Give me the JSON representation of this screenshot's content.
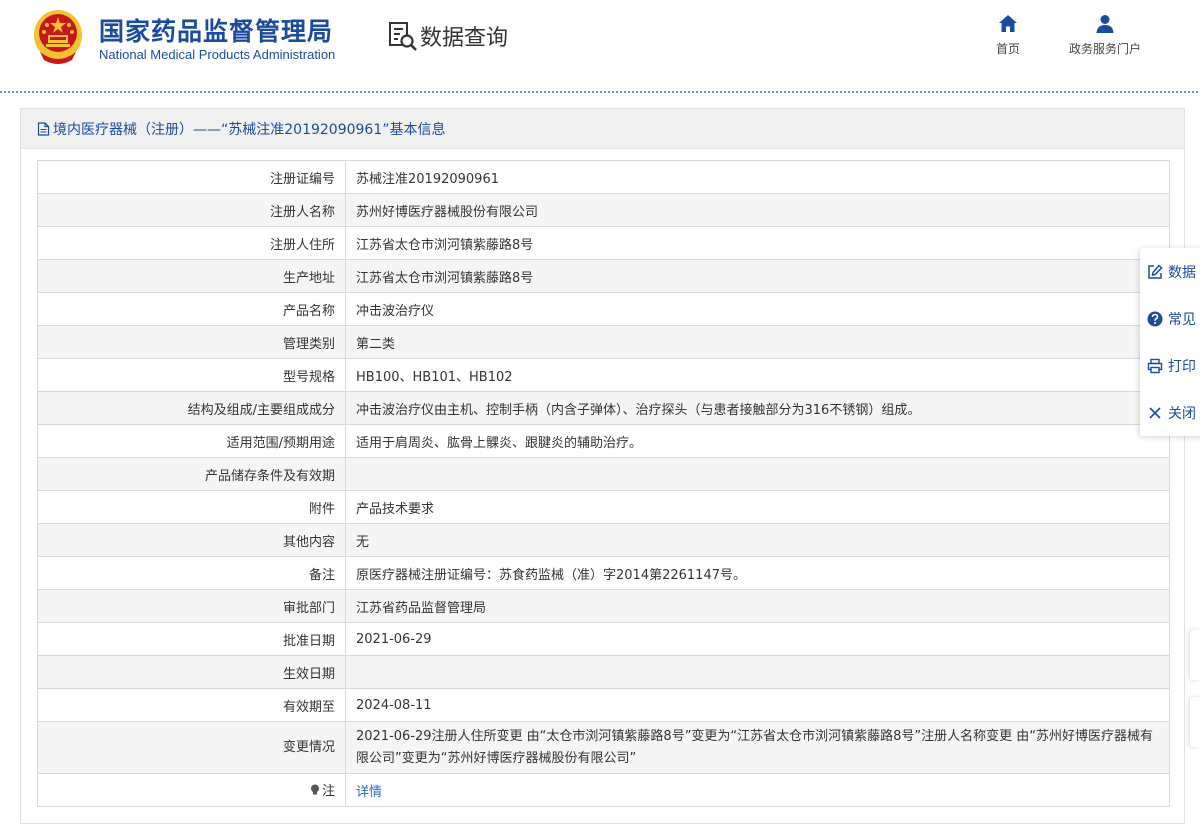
{
  "header": {
    "agency_cn": "国家药品监督管理局",
    "agency_en": "National Medical Products Administration",
    "query_title": "数据查询",
    "nav": {
      "home": "首页",
      "portal": "政务服务门户"
    }
  },
  "panel": {
    "title": "境内医疗器械（注册）——“苏械注准20192090961”基本信息"
  },
  "rows": [
    {
      "label": "注册证编号",
      "value": "苏械注准20192090961"
    },
    {
      "label": "注册人名称",
      "value": "苏州好博医疗器械股份有限公司"
    },
    {
      "label": "注册人住所",
      "value": "江苏省太仓市浏河镇紫藤路8号"
    },
    {
      "label": "生产地址",
      "value": "江苏省太仓市浏河镇紫藤路8号"
    },
    {
      "label": "产品名称",
      "value": "冲击波治疗仪"
    },
    {
      "label": "管理类别",
      "value": "第二类"
    },
    {
      "label": "型号规格",
      "value": "HB100、HB101、HB102"
    },
    {
      "label": "结构及组成/主要组成成分",
      "value": "冲击波治疗仪由主机、控制手柄（内含子弹体）、治疗探头（与患者接触部分为316不锈钢）组成。"
    },
    {
      "label": "适用范围/预期用途",
      "value": "适用于肩周炎、肱骨上髁炎、跟腱炎的辅助治疗。"
    },
    {
      "label": "产品储存条件及有效期",
      "value": ""
    },
    {
      "label": "附件",
      "value": "产品技术要求"
    },
    {
      "label": "其他内容",
      "value": "无"
    },
    {
      "label": "备注",
      "value": "原医疗器械注册证编号：苏食药监械（准）字2014第2261147号。"
    },
    {
      "label": "审批部门",
      "value": "江苏省药品监督管理局"
    },
    {
      "label": "批准日期",
      "value": "2021-06-29"
    },
    {
      "label": "生效日期",
      "value": ""
    },
    {
      "label": "有效期至",
      "value": "2024-08-11"
    },
    {
      "label": "变更情况",
      "value": "2021-06-29注册人住所变更 由“太仓市浏河镇紫藤路8号”变更为“江苏省太仓市浏河镇紫藤路8号”注册人名称变更 由“苏州好博医疗器械有限公司”变更为“苏州好博医疗器械股份有限公司”"
    }
  ],
  "note": {
    "label": "注",
    "link": "详情"
  },
  "float_menu": [
    {
      "icon": "edit-icon",
      "label": "数据"
    },
    {
      "icon": "question-icon",
      "label": "常见"
    },
    {
      "icon": "printer-icon",
      "label": "打印"
    },
    {
      "icon": "close-icon",
      "label": "关闭"
    }
  ],
  "colors": {
    "brand": "#1b4c9b",
    "link": "#2a6bc1",
    "emblem_red": "#c8161d",
    "emblem_gold": "#f2c230"
  }
}
